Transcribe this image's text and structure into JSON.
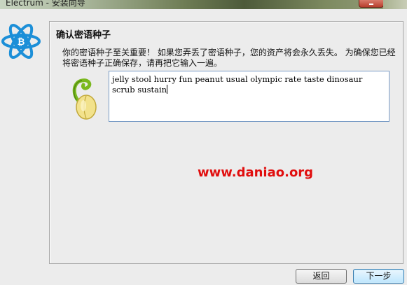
{
  "window": {
    "title": "Electrum  -  安装向导"
  },
  "panel": {
    "title": "确认密语种子",
    "message": "你的密语种子至关重要！ 如果您弄丢了密语种子，您的资产将会永久丢失。 为确保您已经将密语种子正确保存，请再把它输入一遍。"
  },
  "seed_input": {
    "value": "jelly stool hurry fun peanut usual olympic rate taste dinosaur scrub sustain"
  },
  "watermark": "www.daniao.org",
  "buttons": {
    "back_label": "返回",
    "next_label": "下一步"
  },
  "colors": {
    "logo_blue": "#1c8fd8",
    "watermark_red": "#e10e0e",
    "seed_green": "#7ab81e"
  }
}
